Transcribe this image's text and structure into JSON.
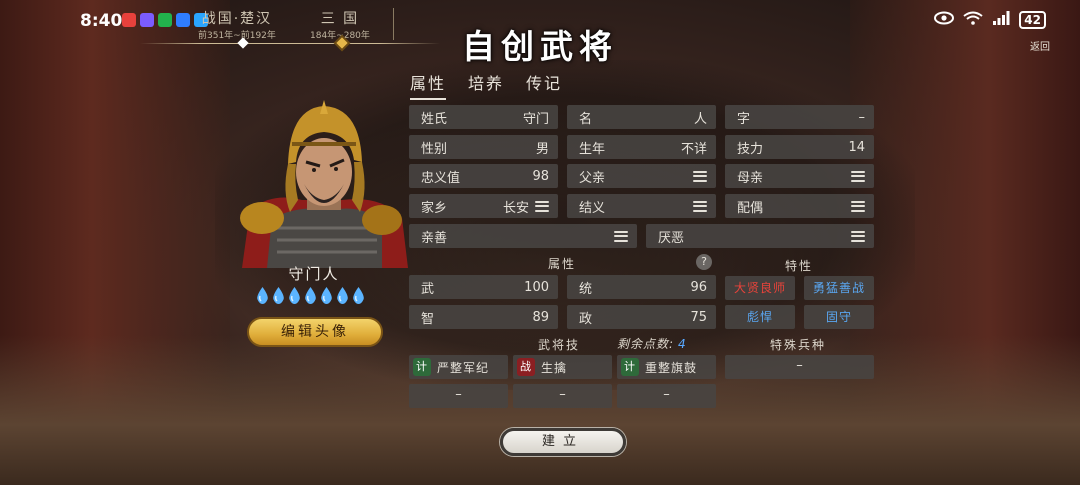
{
  "status_bar": {
    "time": "8:40",
    "battery": "42",
    "app_icon_colors": [
      "#e8413c",
      "#7b5cff",
      "#22b24c",
      "#2f7dff",
      "#2aa5ff"
    ]
  },
  "eras": [
    {
      "name": "战国·楚汉",
      "range": "前351年~前192年"
    },
    {
      "name": "三 国",
      "range": "184年~280年"
    }
  ],
  "back_label": "返回",
  "title": "自创武将",
  "tabs": [
    {
      "label": "属性",
      "active": true
    },
    {
      "label": "培养",
      "active": false
    },
    {
      "label": "传记",
      "active": false
    }
  ],
  "hero": {
    "name": "守门人",
    "level_drops": 7,
    "edit_avatar_label": "编辑头像"
  },
  "profile": {
    "surname": {
      "label": "姓氏",
      "value": "守门"
    },
    "given_name": {
      "label": "名",
      "value": "人"
    },
    "courtesy": {
      "label": "字",
      "value": "–"
    },
    "gender": {
      "label": "性别",
      "value": "男"
    },
    "birth_year": {
      "label": "生年",
      "value": "不详"
    },
    "skill_power": {
      "label": "技力",
      "value": "14"
    },
    "loyalty": {
      "label": "忠义值",
      "value": "98"
    },
    "father": {
      "label": "父亲"
    },
    "mother": {
      "label": "母亲"
    },
    "hometown": {
      "label": "家乡",
      "value": "长安"
    },
    "sworn": {
      "label": "结义"
    },
    "spouse": {
      "label": "配偶"
    },
    "likes": {
      "label": "亲善"
    },
    "dislikes": {
      "label": "厌恶"
    }
  },
  "attributes": {
    "heading": "属性",
    "help": "?",
    "items": [
      {
        "label": "武",
        "value": "100"
      },
      {
        "label": "统",
        "value": "96"
      },
      {
        "label": "智",
        "value": "89"
      },
      {
        "label": "政",
        "value": "75"
      }
    ]
  },
  "traits": {
    "heading": "特性",
    "items": [
      {
        "label": "大贤良师",
        "color": "#e8433a"
      },
      {
        "label": "勇猛善战",
        "color": "#5aa6f0"
      },
      {
        "label": "彪悍",
        "color": "#5aa6f0"
      },
      {
        "label": "固守",
        "color": "#5aa6f0"
      }
    ]
  },
  "skills": {
    "heading": "武将技",
    "remaining_label": "剩余点数:",
    "remaining_value": "4",
    "items": [
      {
        "badge": "计",
        "badge_type": "green",
        "label": "严整军纪"
      },
      {
        "badge": "战",
        "badge_type": "red",
        "label": "生擒"
      },
      {
        "badge": "计",
        "badge_type": "green",
        "label": "重整旗鼓"
      }
    ],
    "empty_slots": [
      "–",
      "–",
      "–"
    ]
  },
  "special_troop": {
    "heading": "特殊兵种",
    "value": "–"
  },
  "build_label": "建立"
}
